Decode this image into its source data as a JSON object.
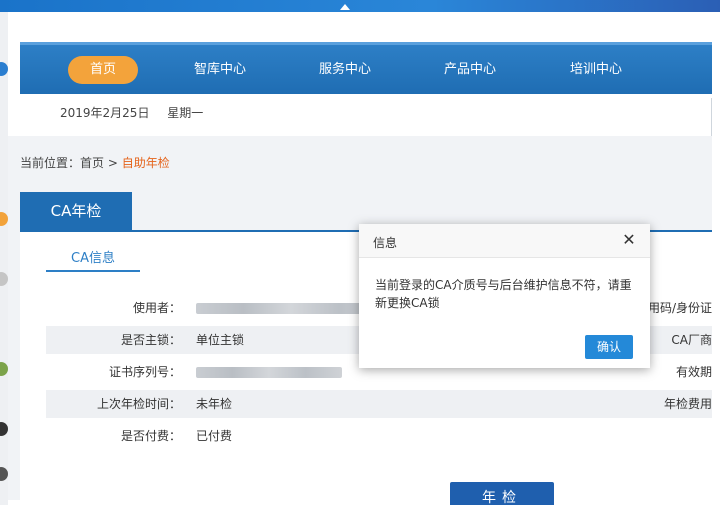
{
  "nav": {
    "items": [
      "首页",
      "智库中心",
      "服务中心",
      "产品中心",
      "培训中心"
    ],
    "active_index": 0
  },
  "date": {
    "date": "2019年2月25日",
    "weekday": "星期一"
  },
  "breadcrumb": {
    "prefix": "当前位置：",
    "home": "首页",
    "sep": ">",
    "current": "自助年检"
  },
  "tab": {
    "label": "CA年检"
  },
  "subtab": {
    "label": "CA信息"
  },
  "fields": {
    "user_label": "使用者：",
    "user_right": "用码/身份证",
    "primary_label": "是否主锁：",
    "primary_value": "单位主锁",
    "primary_right": "CA厂商",
    "serial_label": "证书序列号：",
    "serial_right": "有效期",
    "last_check_label": "上次年检时间：",
    "last_check_value": "未年检",
    "last_check_right": "年检费用",
    "paid_label": "是否付费：",
    "paid_value": "已付费"
  },
  "annual_button": "年检",
  "modal": {
    "title": "信息",
    "message": "当前登录的CA介质号与后台维护信息不符，请重新更换CA锁",
    "ok": "确认"
  },
  "colors": {
    "nav_blue": "#1f6db3",
    "active_orange": "#f3a33b",
    "breadcrumb_current": "#e5641c",
    "ok_button": "#2489d8"
  }
}
